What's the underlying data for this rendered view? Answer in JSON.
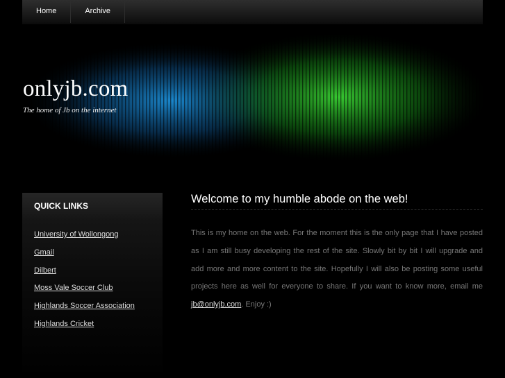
{
  "nav": [
    {
      "label": "Home"
    },
    {
      "label": "Archive"
    }
  ],
  "header": {
    "title": "onlyjb.com",
    "tagline": "The home of Jb on the internet"
  },
  "sidebar": {
    "heading": "QUICK LINKS",
    "links": [
      {
        "label": "University of Wollongong"
      },
      {
        "label": "Gmail"
      },
      {
        "label": "Dilbert"
      },
      {
        "label": "Moss Vale Soccer Club"
      },
      {
        "label": "Highlands Soccer Association"
      },
      {
        "label": "Highlands Cricket"
      }
    ]
  },
  "main": {
    "heading": "Welcome to my humble abode on the web!",
    "body_before": "This is my home on the web. For the moment this is the only page that I have posted as I am still busy developing the rest of the site. Slowly bit by bit I will upgrade and add more and more content to the site. Hopefully I will also be posting some useful projects here as well for everyone to share. If you want to know more, email me ",
    "email": "jb@onlyjb.com",
    "body_after": ". Enjoy :)"
  },
  "colors": {
    "background": "#000000",
    "banner_blue": "#1a7fc4",
    "banner_green": "#2ec22a"
  }
}
